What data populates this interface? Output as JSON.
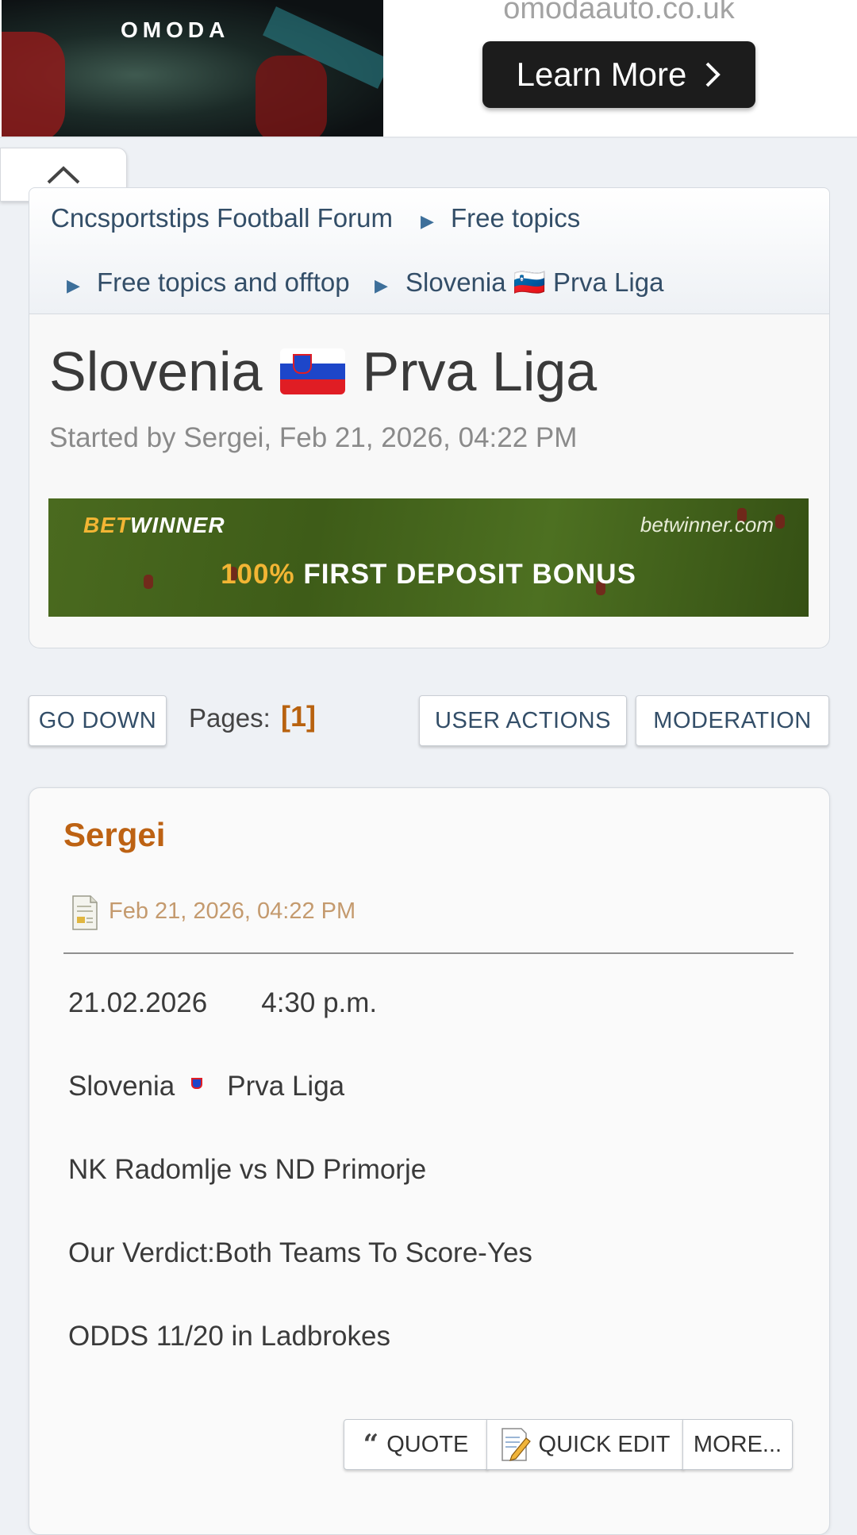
{
  "ad": {
    "brand": "OMODA",
    "url": "omodaauto.co.uk",
    "cta": "Learn More",
    "icons": {
      "cta": "chevron-right-icon",
      "collapse": "chevron-up-icon"
    }
  },
  "breadcrumb": {
    "items": [
      {
        "label": "Cncsportstips Football Forum"
      },
      {
        "label": "Free topics"
      },
      {
        "label": "Free topics and offtop"
      },
      {
        "label": "Slovenia 🇸🇮 Prva Liga"
      }
    ]
  },
  "topic": {
    "title_prefix": "Slovenia",
    "title_suffix": "Prva Liga",
    "started_by": "Started by Sergei, Feb 21, 2026, 04:22 PM"
  },
  "promo": {
    "brand_a": "BET",
    "brand_b": "WINNER",
    "site": "betwinner.com",
    "offer_highlight": "100%",
    "offer_text": "FIRST DEPOSIT BONUS"
  },
  "actions": {
    "go_down": "GO DOWN",
    "pages_label": "Pages:",
    "current_page": "[1]",
    "user_actions": "USER ACTIONS",
    "moderation": "MODERATION"
  },
  "post": {
    "author": "Sergei",
    "date": "Feb 21, 2026, 04:22 PM",
    "date_line": "21.02.2026       4:30 p.m.",
    "league_prefix": "Slovenia",
    "league_suffix": "Prva Liga",
    "match": "NK Radomlje vs ND Primorje",
    "verdict": "Our Verdict:Both Teams To Score-Yes",
    "odds": "ODDS 11/20 in Ladbrokes",
    "buttons": {
      "quote": "QUOTE",
      "quick_edit": "QUICK EDIT",
      "more": "MORE..."
    }
  },
  "colors": {
    "accent_orange": "#bd6213",
    "link_blue": "#334e68",
    "slovenia_flag": [
      "#ffffff",
      "#1d46c9",
      "#e01d24"
    ]
  }
}
